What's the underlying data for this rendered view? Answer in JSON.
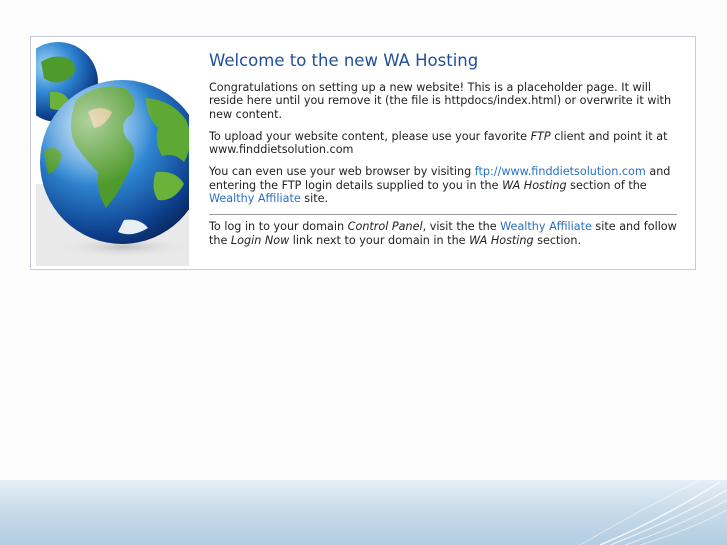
{
  "header": {
    "title": "Welcome to the new WA Hosting"
  },
  "p1": {
    "text": "Congratulations on setting up a new website! This is a placeholder page. It will reside here until you remove it (the file is httpdocs/index.html) or overwrite it with new content."
  },
  "p2": {
    "before": "To upload your website content, please use your favorite ",
    "ftp": "FTP",
    "after": " client and point it at www.finddietsolution.com"
  },
  "p3": {
    "before": "You can even use your web browser by visiting ",
    "link": "ftp://www.finddietsolution.com",
    "middle": " and entering the FTP login details supplied to you in the ",
    "em": "WA Hosting",
    "middle2": " section of the ",
    "link2": "Wealthy Affiliate",
    "after": " site."
  },
  "p4": {
    "before": "To log in to your domain ",
    "em1": "Control Panel",
    "mid1": ", visit the the ",
    "link": "Wealthy Affiliate",
    "mid2": " site and follow the ",
    "em2": "Login Now",
    "mid3": " link next to your domain in the ",
    "em3": "WA Hosting",
    "after": " section."
  },
  "colors": {
    "title": "#1f4f9a",
    "link": "#2a6fc4",
    "border": "#c9c9d7"
  },
  "icons": {
    "illustration": "globe-icon"
  }
}
